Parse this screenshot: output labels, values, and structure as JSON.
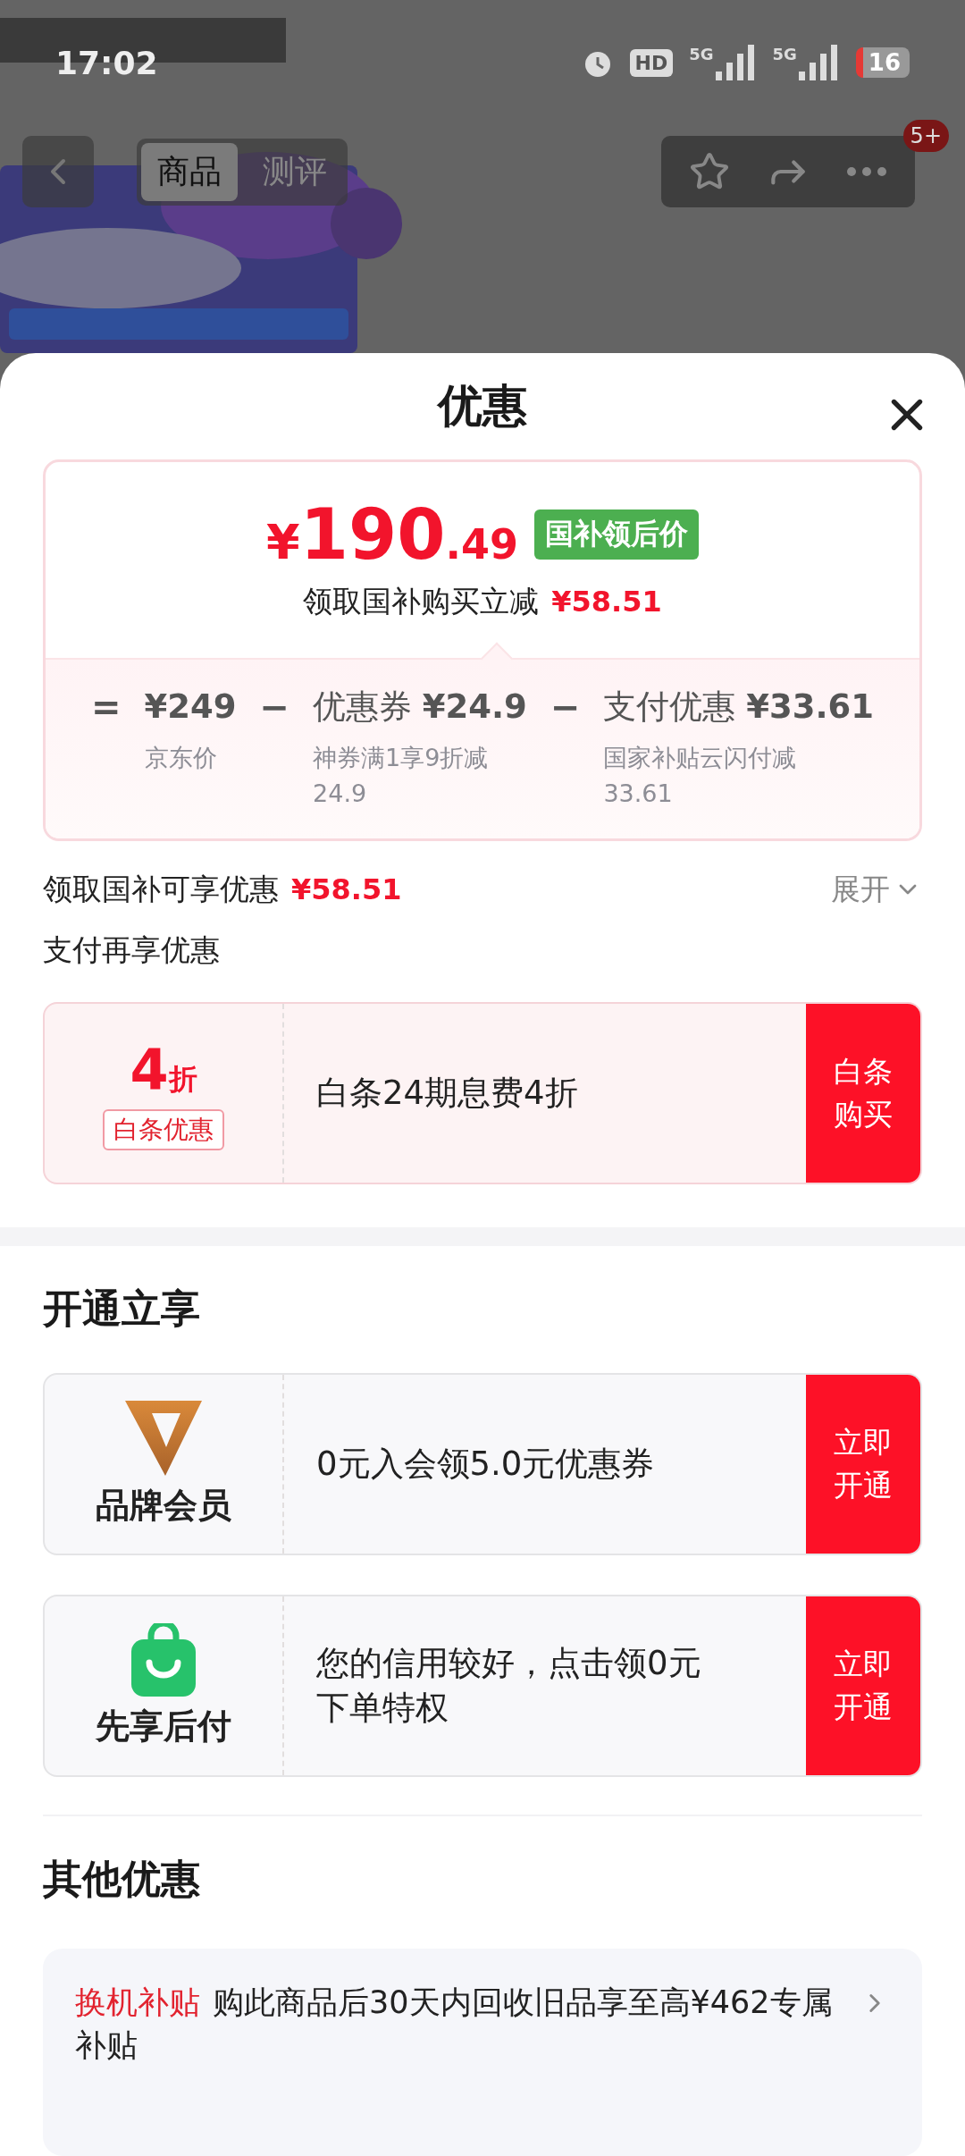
{
  "status_bar": {
    "time": "17:02",
    "hd": "HD",
    "networks": [
      "5G",
      "5G"
    ],
    "battery": "16"
  },
  "header": {
    "tabs": [
      {
        "label": "商品",
        "selected": true
      },
      {
        "label": "测评",
        "selected": false
      }
    ],
    "badge": "5+"
  },
  "sheet": {
    "title": "优惠",
    "price_card": {
      "currency": "¥",
      "integer": "190",
      "decimal": ".49",
      "tag": "国补领后价",
      "subtitle": "领取国补购买立减",
      "saving": "¥58.51",
      "breakdown": [
        {
          "operator": "=",
          "value": "¥249",
          "label": "京东价"
        },
        {
          "operator": "−",
          "prefix": "优惠券",
          "value": "¥24.9",
          "label": "神券满1享9折减24.9"
        },
        {
          "operator": "−",
          "prefix": "支付优惠",
          "value": "¥33.61",
          "label": "国家补贴云闪付减33.61"
        }
      ]
    },
    "subsidy_row": {
      "label": "领取国补可享优惠",
      "amount": "¥58.51",
      "expand": "展开"
    },
    "pay_more": {
      "title": "支付再享优惠",
      "offers": [
        {
          "kind": "discount",
          "value": "4",
          "unit": "折",
          "tag": "白条优惠",
          "text": "白条24期息费4折",
          "button": "白条购买"
        }
      ]
    },
    "open_section": {
      "title": "开通立享",
      "offers": [
        {
          "kind": "membership",
          "name": "品牌会员",
          "text": "0元入会领5.0元优惠券",
          "button": "立即开通"
        },
        {
          "kind": "paylater",
          "name": "先享后付",
          "text": "您的信用较好，点击领0元下单特权",
          "button": "立即开通"
        }
      ]
    },
    "other_section": {
      "title": "其他优惠",
      "items": [
        {
          "tag": "换机补贴",
          "text": "购此商品后30天内回收旧品享至高¥462专属补贴"
        }
      ]
    }
  }
}
